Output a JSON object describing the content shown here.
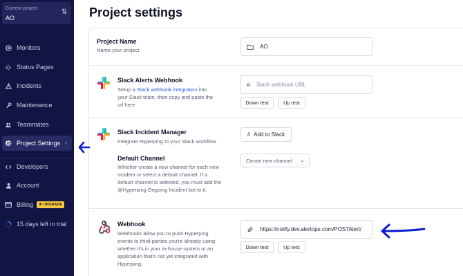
{
  "sidebar": {
    "project_switcher": {
      "caption": "Current project",
      "value": "AO",
      "icon": "swap-vertical-icon"
    },
    "items": [
      {
        "label": "Monitors",
        "icon": "monitor-icon"
      },
      {
        "label": "Status Pages",
        "icon": "status-page-icon"
      },
      {
        "label": "Incidents",
        "icon": "incident-icon"
      },
      {
        "label": "Maintenance",
        "icon": "wrench-icon"
      },
      {
        "label": "Teammates",
        "icon": "teammates-icon"
      },
      {
        "label": "Project Settings",
        "icon": "gear-icon",
        "active": true
      },
      {
        "label": "Developers",
        "icon": "code-icon"
      },
      {
        "label": "Account",
        "icon": "user-icon"
      },
      {
        "label": "Billing",
        "icon": "card-icon",
        "badge": "UPGRADE"
      },
      {
        "label": "15 days left in trial",
        "icon": "trial-progress-icon"
      }
    ]
  },
  "main": {
    "title": "Project settings",
    "project_name": {
      "title": "Project Name",
      "description": "Name your project",
      "value": "AO"
    },
    "slack_webhook": {
      "title": "Slack Alerts Webhook",
      "desc_before": "Setup a ",
      "link_text": "Slack webhook integration",
      "desc_after": " into your Slack team, then copy and paste the url here",
      "placeholder": "Slack webhook URL",
      "down_test": "Down test",
      "up_test": "Up test"
    },
    "slack_incident": {
      "title": "Slack Incident Manager",
      "description": "Integrate Hyperping to your Slack workflow",
      "button": "Add to Slack",
      "default_channel_title": "Default Channel",
      "default_channel_desc": "Whether create a new channel for each new incident or select a default channel. If a default channel is selected, you must add the @Hyperping Ongoing Incident bot to it.",
      "select_value": "Create new channel"
    },
    "webhook": {
      "title": "Webhook",
      "description": "Webhooks allow you to push Hyperping events to third-parties you're already using whether it's in your in-house system or an application that's not yet integrated with Hyperping.",
      "value": "https://notify.dev.alertops.com/POSTAlert/",
      "down_test": "Down test",
      "up_test": "Up test"
    }
  },
  "colors": {
    "sidebar_bg": "#111544",
    "accent_link": "#2a5bd7",
    "annotation_arrow": "#0a1ccf",
    "upgrade_badge": "#f6c744"
  }
}
